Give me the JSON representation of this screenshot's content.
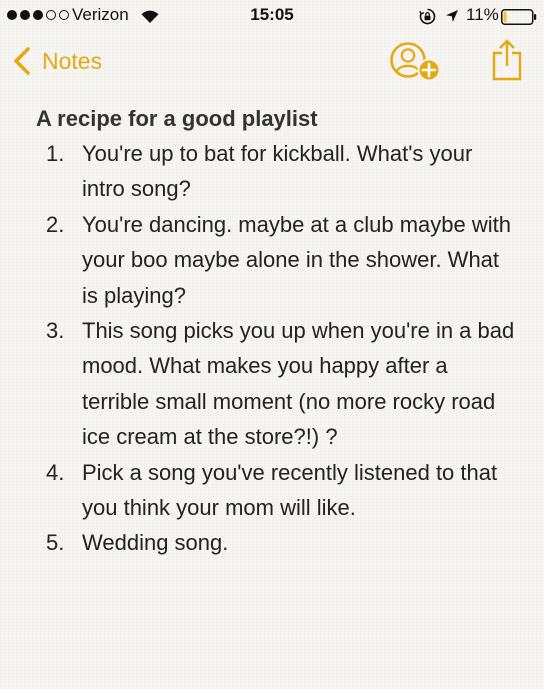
{
  "status_bar": {
    "carrier": "Verizon",
    "signal_strength": 3,
    "time": "15:05",
    "battery_percent": "11%",
    "battery_level": 0.11
  },
  "nav": {
    "back_label": "Notes",
    "accent_color": "#e4a913"
  },
  "note": {
    "title": "A recipe for a good playlist",
    "items": [
      {
        "number": "1.",
        "text": "You're up to bat for kickball. What's your intro song?"
      },
      {
        "number": "2.",
        "text": "You're dancing. maybe at a club maybe with your boo maybe alone in the shower. What is playing?"
      },
      {
        "number": "3.",
        "text": "This song picks you up when you're in a bad mood. What makes you happy after a terrible small moment (no more rocky road ice cream at the store?!) ?"
      },
      {
        "number": "4.",
        "text": "Pick a song you've recently listened to that you think your mom will like."
      },
      {
        "number": "5.",
        "text": "Wedding song."
      }
    ]
  }
}
